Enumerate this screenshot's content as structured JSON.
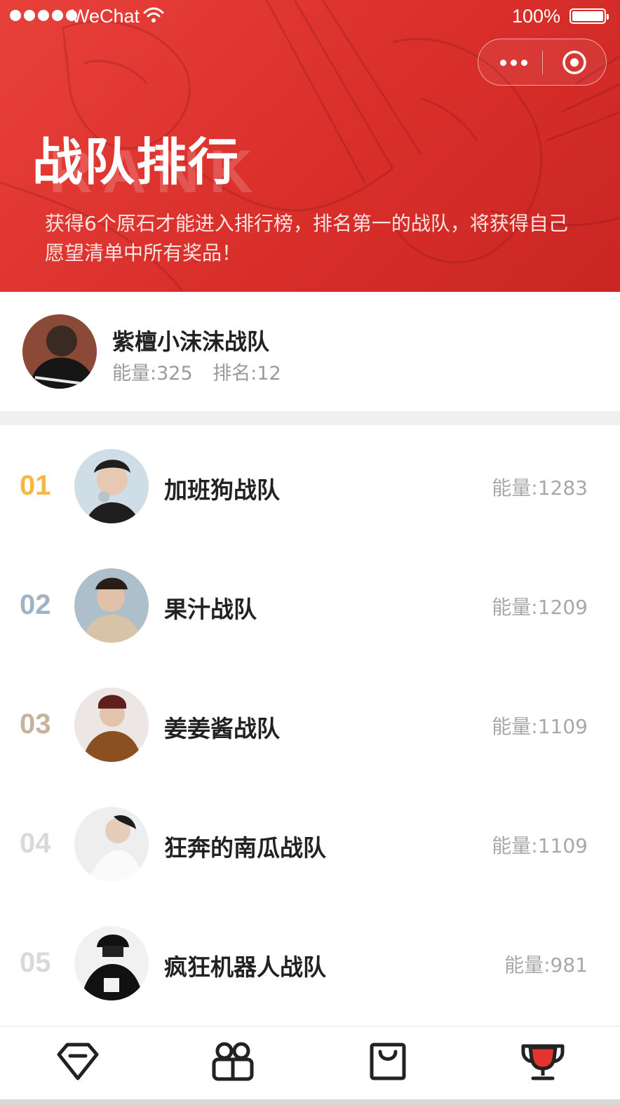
{
  "status_bar": {
    "carrier": "WeChat",
    "battery": "100%"
  },
  "hero": {
    "title": "战队排行",
    "watermark": "RANK",
    "description": "获得6个原石才能进入排行榜，排名第一的战队，将获得自己愿望清单中所有奖品！"
  },
  "my_team": {
    "name": "紫檀小沫沫战队",
    "energy": "能量:325",
    "rank": "排名:12"
  },
  "rankings": [
    {
      "rank": "01",
      "name": "加班狗战队",
      "energy": "能量:1283",
      "rank_color": "#f6b843"
    },
    {
      "rank": "02",
      "name": "果汁战队",
      "energy": "能量:1209",
      "rank_color": "#9fb3c6"
    },
    {
      "rank": "03",
      "name": "姜姜酱战队",
      "energy": "能量:1109",
      "rank_color": "#c7b39d"
    },
    {
      "rank": "04",
      "name": "狂奔的南瓜战队",
      "energy": "能量:1109",
      "rank_color": "#d9d9d9"
    },
    {
      "rank": "05",
      "name": "疯狂机器人战队",
      "energy": "能量:981",
      "rank_color": "#d9d9d9"
    }
  ],
  "tabbar": {
    "tabs": [
      {
        "icon": "diamond-icon"
      },
      {
        "icon": "gift-icon"
      },
      {
        "icon": "shopping-bag-icon"
      },
      {
        "icon": "trophy-icon",
        "active": true
      }
    ],
    "active_color": "#e3342f"
  }
}
